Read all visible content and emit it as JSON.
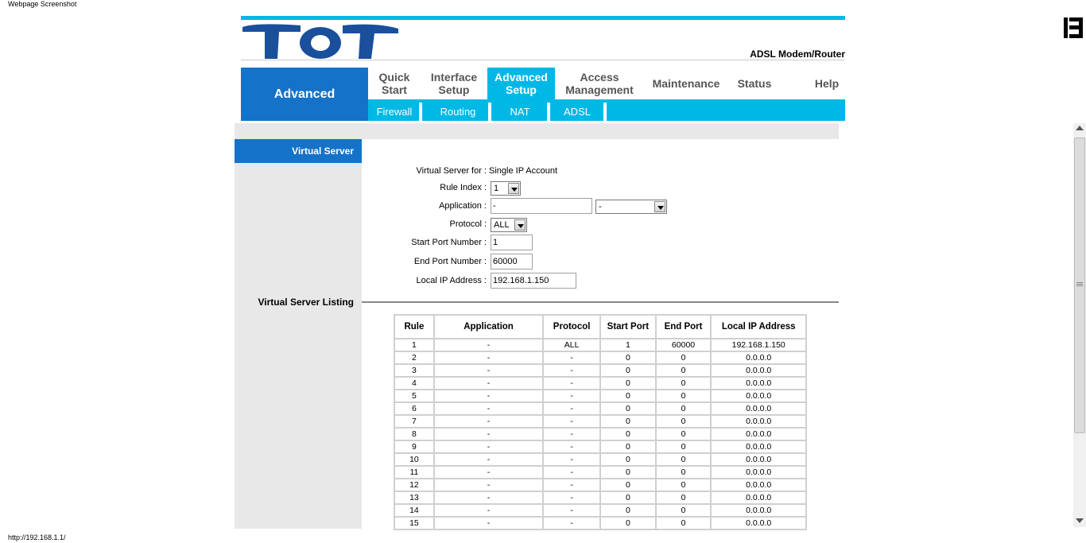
{
  "caption": "Webpage Screenshot",
  "status_url": "http://192.168.1.1/",
  "header": {
    "logo_text": "TOT",
    "product": "ADSL Modem/Router",
    "section": "Advanced",
    "tabs": [
      {
        "label": "Quick Start"
      },
      {
        "label": "Interface Setup"
      },
      {
        "label": "Advanced Setup"
      },
      {
        "label": "Access Management"
      },
      {
        "label": "Maintenance"
      },
      {
        "label": "Status"
      },
      {
        "label": "Help"
      }
    ],
    "subtabs": [
      "Firewall",
      "Routing",
      "NAT",
      "ADSL"
    ]
  },
  "sidebar": {
    "virtual_server": "Virtual Server",
    "listing": "Virtual Server Listing"
  },
  "form": {
    "for_label": "Virtual Server for :",
    "for_value": "Single IP Account",
    "rule_index_label": "Rule Index :",
    "rule_index_value": "1",
    "application_label": "Application :",
    "application_value": "-",
    "application_select": "-",
    "protocol_label": "Protocol :",
    "protocol_value": "ALL",
    "start_port_label": "Start Port Number :",
    "start_port_value": "1",
    "end_port_label": "End Port Number :",
    "end_port_value": "60000",
    "local_ip_label": "Local IP Address :",
    "local_ip_value": "192.168.1.150"
  },
  "table": {
    "headers": [
      "Rule",
      "Application",
      "Protocol",
      "Start Port",
      "End Port",
      "Local IP Address"
    ],
    "rows": [
      [
        "1",
        "-",
        "ALL",
        "1",
        "60000",
        "192.168.1.150"
      ],
      [
        "2",
        "-",
        "-",
        "0",
        "0",
        "0.0.0.0"
      ],
      [
        "3",
        "-",
        "-",
        "0",
        "0",
        "0.0.0.0"
      ],
      [
        "4",
        "-",
        "-",
        "0",
        "0",
        "0.0.0.0"
      ],
      [
        "5",
        "-",
        "-",
        "0",
        "0",
        "0.0.0.0"
      ],
      [
        "6",
        "-",
        "-",
        "0",
        "0",
        "0.0.0.0"
      ],
      [
        "7",
        "-",
        "-",
        "0",
        "0",
        "0.0.0.0"
      ],
      [
        "8",
        "-",
        "-",
        "0",
        "0",
        "0.0.0.0"
      ],
      [
        "9",
        "-",
        "-",
        "0",
        "0",
        "0.0.0.0"
      ],
      [
        "10",
        "-",
        "-",
        "0",
        "0",
        "0.0.0.0"
      ],
      [
        "11",
        "-",
        "-",
        "0",
        "0",
        "0.0.0.0"
      ],
      [
        "12",
        "-",
        "-",
        "0",
        "0",
        "0.0.0.0"
      ],
      [
        "13",
        "-",
        "-",
        "0",
        "0",
        "0.0.0.0"
      ],
      [
        "14",
        "-",
        "-",
        "0",
        "0",
        "0.0.0.0"
      ],
      [
        "15",
        "-",
        "-",
        "0",
        "0",
        "0.0.0.0"
      ]
    ]
  },
  "colors": {
    "accent": "#00b8e6",
    "brand_blue": "#1473c9",
    "panel_gray": "#e8e8e8"
  }
}
